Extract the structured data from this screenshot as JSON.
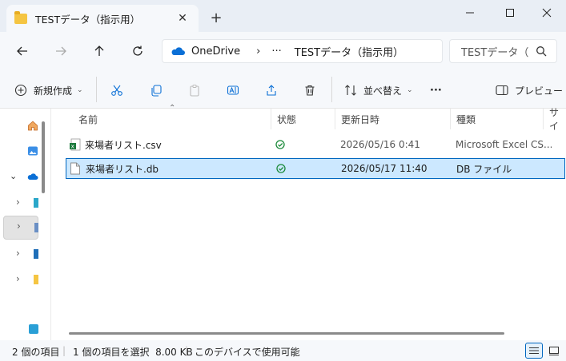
{
  "window": {
    "tab_title": "TESTデータ（指示用）",
    "new_tab": "+"
  },
  "nav": {
    "breadcrumb_root": "OneDrive",
    "breadcrumb_more": "···",
    "breadcrumb_current": "TESTデータ（指示用）",
    "search_placeholder": "TESTデータ（"
  },
  "toolbar": {
    "new_label": "新規作成",
    "sort_label": "並べ替え",
    "more_label": "···",
    "preview_label": "プレビュー"
  },
  "columns": {
    "name": "名前",
    "status": "状態",
    "modified": "更新日時",
    "type": "種類",
    "size": "サイ"
  },
  "files": [
    {
      "name": "来場者リスト.csv",
      "modified": "2026/05/16 0:41",
      "type": "Microsoft Excel CS...",
      "icon": "excel-csv-icon",
      "selected": false
    },
    {
      "name": "来場者リスト.db",
      "modified": "2026/05/17 11:40",
      "type": "DB ファイル",
      "icon": "file-icon",
      "selected": true
    }
  ],
  "status_bar": {
    "item_count": "2 個の項目",
    "selection": "1 個の項目を選択  8.00 KB",
    "availability": "このデバイスで使用可能"
  },
  "colors": {
    "accent": "#0067c0",
    "selection": "#cce8ff",
    "sync_green": "#1b8a3a",
    "folder": "#f5c542"
  }
}
